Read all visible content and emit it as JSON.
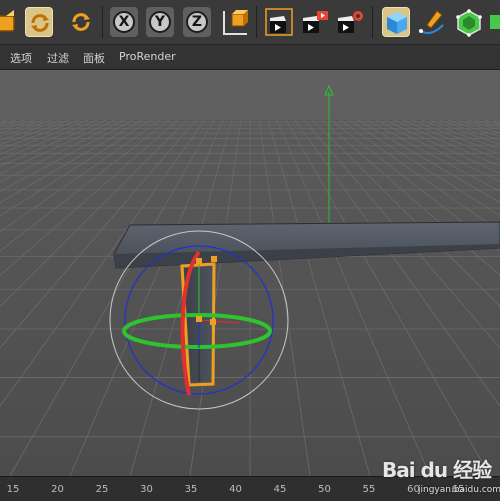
{
  "menubar": {
    "items": [
      "选项",
      "过滤",
      "面板",
      "ProRender"
    ]
  },
  "toolbar": {
    "axis_x": "X",
    "axis_y": "Y",
    "axis_z": "Z",
    "icons": [
      "scale-icon",
      "rotate-icon",
      "rotate-icon",
      "axis-x-lock-icon",
      "axis-y-lock-icon",
      "axis-z-lock-icon",
      "coordinate-system-icon",
      "render-view-icon",
      "render-picture-viewer-icon",
      "render-settings-icon",
      "cube-primitive-icon",
      "pen-spline-icon",
      "subdivision-generator-icon",
      "array-icon"
    ],
    "accent": "#f0a020"
  },
  "timeline": {
    "ticks": [
      "15",
      "20",
      "25",
      "30",
      "35",
      "40",
      "45",
      "50",
      "55",
      "60",
      "65"
    ]
  },
  "watermark": {
    "logo": "Bai du 经验",
    "site": "jingyan.baidu.com"
  },
  "gizmo": {
    "x_axis_color": "#e83030",
    "y_axis_color": "#30c030",
    "z_axis_color": "#2030d0",
    "selection_color": "#f0a020"
  }
}
